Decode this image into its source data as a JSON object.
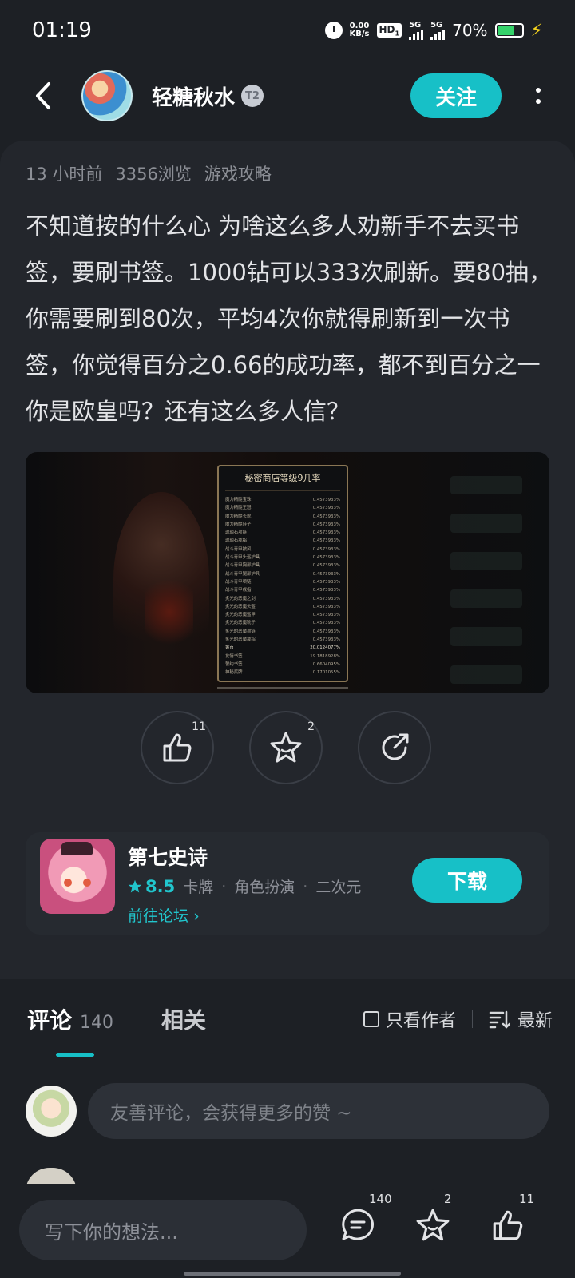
{
  "status_bar": {
    "time": "01:19",
    "net_speed_value": "0.00",
    "net_speed_unit": "KB/s",
    "hd_label": "HD",
    "hd_sub": "1",
    "signal1_label": "5G",
    "signal2_label": "5G",
    "battery_text": "70%",
    "battery_level": 0.7
  },
  "header": {
    "author_name": "轻糖秋水",
    "level_badge": "T2",
    "follow_label": "关注"
  },
  "post": {
    "meta": [
      "13 小时前",
      "3356浏览",
      "游戏攻略"
    ],
    "text": "不知道按的什么心 为啥这么多人劝新手不去买书签，要刷书签。1000钻可以333次刷新。要80抽，你需要刷到80次，平均4次你就得刷新到一次书签，你觉得百分之0.66的成功率，都不到百分之一你是欧皇吗？还有这么多人信？",
    "image": {
      "popup_title": "秘密商店等级9几率",
      "rows": [
        {
          "name": "魔力精髓宝珠",
          "rate": "0.4573933%"
        },
        {
          "name": "魔力精髓王冠",
          "rate": "0.4573933%"
        },
        {
          "name": "魔力精髓长靴",
          "rate": "0.4573933%"
        },
        {
          "name": "魔力精髓鞋子",
          "rate": "0.4573933%"
        },
        {
          "name": "琥珀石项链",
          "rate": "0.4573933%"
        },
        {
          "name": "琥珀石戒指",
          "rate": "0.4573933%"
        },
        {
          "name": "战斗青甲披风",
          "rate": "0.4573933%"
        },
        {
          "name": "战斗青甲头盔护具",
          "rate": "0.4573933%"
        },
        {
          "name": "战斗青甲胸部护具",
          "rate": "0.4573933%"
        },
        {
          "name": "战斗青甲腿部护具",
          "rate": "0.4573933%"
        },
        {
          "name": "战斗青甲项链",
          "rate": "0.4573933%"
        },
        {
          "name": "战斗青甲戒指",
          "rate": "0.4573933%"
        },
        {
          "name": "炙光的恶魔之剑",
          "rate": "0.4573933%"
        },
        {
          "name": "炙光的恶魔头盔",
          "rate": "0.4573933%"
        },
        {
          "name": "炙光的恶魔盔甲",
          "rate": "0.4573933%"
        },
        {
          "name": "炙光的恶魔靴子",
          "rate": "0.4573933%"
        },
        {
          "name": "炙光的恶魔项链",
          "rate": "0.4573933%"
        },
        {
          "name": "炙光的恶魔戒指",
          "rate": "0.4573933%"
        },
        {
          "name": "黄币",
          "rate": "20.0124077%",
          "highlight": true
        },
        {
          "name": "友情书签",
          "rate": "19.1818928%"
        },
        {
          "name": "誓约书签",
          "rate": "0.6604095%"
        },
        {
          "name": "神秘奖牌",
          "rate": "0.1701055%"
        }
      ]
    }
  },
  "actions": {
    "like_count": "11",
    "favorite_count": "2"
  },
  "game": {
    "title": "第七史诗",
    "rating": "8.5",
    "tags": [
      "卡牌",
      "角色扮演",
      "二次元"
    ],
    "forum_link": "前往论坛",
    "download_label": "下载"
  },
  "comments": {
    "tab_comments": "评论",
    "tab_comments_count": "140",
    "tab_related": "相关",
    "only_author_label": "只看作者",
    "sort_label": "最新",
    "input_placeholder": "友善评论，会获得更多的赞 ~"
  },
  "bottom_bar": {
    "input_placeholder": "写下你的想法...",
    "comment_count": "140",
    "favorite_count": "2",
    "like_count": "11"
  },
  "colors": {
    "accent": "#17c0c7",
    "background": "#1d2025",
    "card": "#23262c"
  }
}
